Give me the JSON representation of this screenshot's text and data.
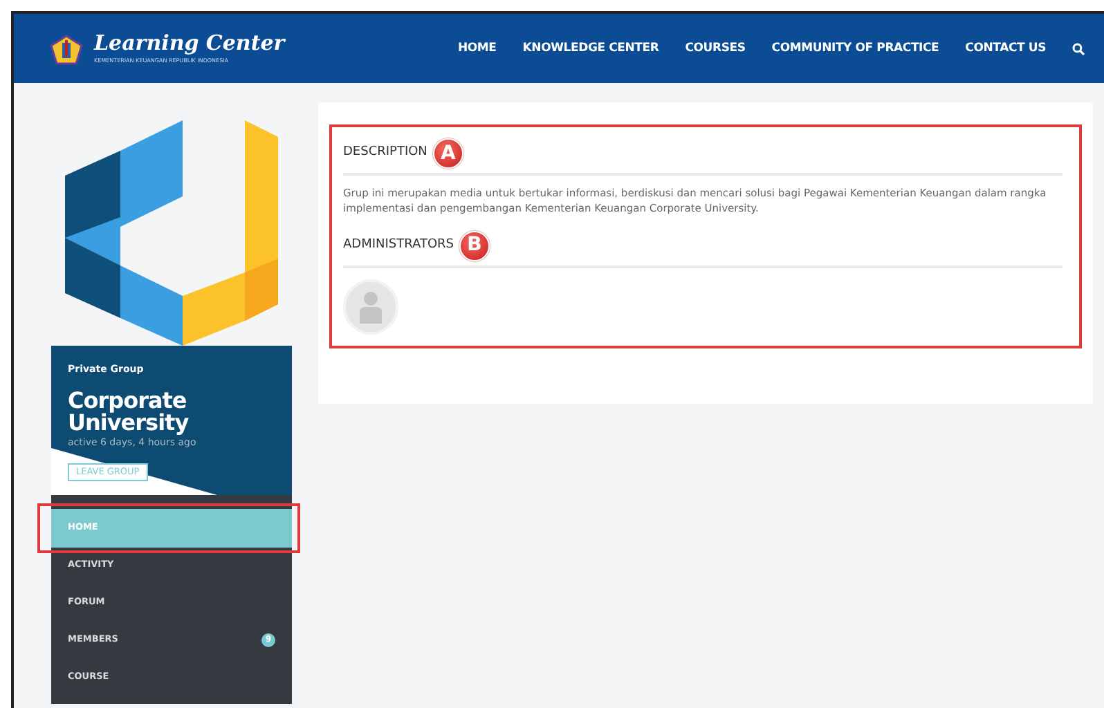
{
  "header": {
    "logo_title": "Learning Center",
    "logo_subtitle": "KEMENTERIAN KEUANGAN REPUBLIK INDONESIA",
    "nav": [
      {
        "label": "HOME"
      },
      {
        "label": "KNOWLEDGE CENTER"
      },
      {
        "label": "COURSES"
      },
      {
        "label": "COMMUNITY OF PRACTICE"
      },
      {
        "label": "CONTACT US"
      }
    ]
  },
  "group": {
    "privacy": "Private Group",
    "name": "Corporate University",
    "activity": "active 6 days, 4 hours ago",
    "button": "LEAVE GROUP"
  },
  "menu": [
    {
      "label": "HOME",
      "selected": true,
      "highlighted": true
    },
    {
      "label": "ACTIVITY",
      "selected": false,
      "highlighted": false
    },
    {
      "label": "FORUM",
      "selected": false,
      "highlighted": false
    },
    {
      "label": "MEMBERS",
      "selected": false,
      "highlighted": false,
      "count": "9"
    },
    {
      "label": "COURSE",
      "selected": false,
      "highlighted": false
    }
  ],
  "content": {
    "highlighted": true,
    "sections": [
      {
        "kind": "text",
        "heading": "DESCRIPTION",
        "marker": "A",
        "text": "Grup ini merupakan media untuk bertukar informasi, berdiskusi dan mencari solusi bagi Pegawai Kementerian Keuangan dalam rangka implementasi dan pengembangan Kementerian Keuangan Corporate University."
      },
      {
        "kind": "avatars",
        "heading": "ADMINISTRATORS",
        "marker": "B",
        "avatars": [
          {
            "kind": "default"
          }
        ]
      }
    ]
  }
}
